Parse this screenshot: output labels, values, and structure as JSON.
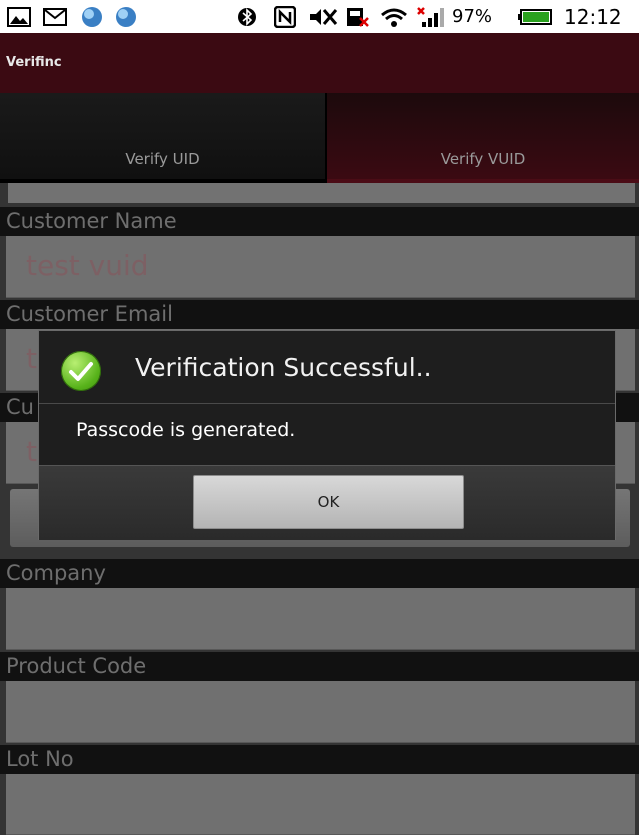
{
  "status_bar": {
    "battery_percent": "97%",
    "time": "12:12",
    "icons": [
      "image-icon",
      "gmail-icon",
      "app-icon",
      "app-icon",
      "bluetooth-icon",
      "nfc-icon",
      "mute-icon",
      "data-icon",
      "wifi-icon",
      "signal-icon",
      "battery-icon"
    ]
  },
  "app_bar": {
    "title": "Verifinc"
  },
  "tabs": [
    {
      "label": "Verify UID",
      "selected": false
    },
    {
      "label": "Verify VUID",
      "selected": true
    }
  ],
  "form": {
    "fields": [
      {
        "label": "Customer Name",
        "value": "test vuid"
      },
      {
        "label": "Customer Email",
        "value": "t"
      },
      {
        "label": "Cu",
        "value": "t"
      },
      {
        "label": "Company",
        "value": ""
      },
      {
        "label": "Product Code",
        "value": ""
      },
      {
        "label": "Lot No",
        "value": ""
      }
    ]
  },
  "dialog": {
    "icon": "check-circle-icon",
    "title": "Verification Successful..",
    "message": "Passcode is generated.",
    "ok_label": "OK"
  },
  "colors": {
    "app_bar": "#3b0a12",
    "selected_tab": "#3b0a12",
    "field_text": "#e3b0b6",
    "success": "#57b21a"
  }
}
